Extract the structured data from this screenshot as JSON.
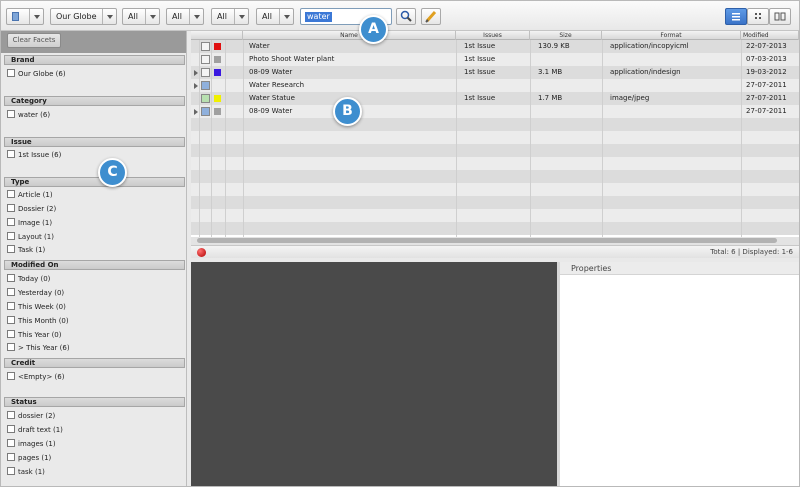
{
  "toolbar": {
    "brand_dropdown": "Our Globe",
    "filters": [
      "All",
      "All",
      "All",
      "All"
    ],
    "search_value": "water",
    "accent": "#3b78d6"
  },
  "callouts": [
    "A",
    "B",
    "C"
  ],
  "facets": {
    "clear_label": "Clear Facets",
    "groups": [
      {
        "title": "Brand",
        "items": [
          "Our Globe (6)"
        ]
      },
      {
        "title": "Category",
        "items": [
          "water (6)"
        ]
      },
      {
        "title": "Issue",
        "items": [
          "1st Issue (6)"
        ]
      },
      {
        "title": "Type",
        "items": [
          "Article (1)",
          "Dossier (2)",
          "Image (1)",
          "Layout (1)",
          "Task (1)"
        ]
      },
      {
        "title": "Modified On",
        "items": [
          "Today (0)",
          "Yesterday (0)",
          "This Week (0)",
          "This Month (0)",
          "This Year (0)",
          "> This Year (6)"
        ]
      },
      {
        "title": "Credit",
        "items": [
          "<Empty> (6)"
        ]
      },
      {
        "title": "Status",
        "items": [
          "dossier (2)",
          "draft text (1)",
          "images (1)",
          "pages (1)",
          "task (1)"
        ]
      }
    ]
  },
  "grid": {
    "columns": [
      "Name",
      "Issues",
      "Size",
      "Format",
      "Modified"
    ],
    "rows": [
      {
        "name": "Water",
        "issue": "1st Issue",
        "size": "130.9 KB",
        "format": "application/incopyicml",
        "modified": "22-07-2013",
        "color": "#e01010",
        "icon": "article-icon",
        "expandable": false
      },
      {
        "name": "Photo Shoot Water plant",
        "issue": "1st Issue",
        "size": "",
        "format": "",
        "modified": "07-03-2013",
        "color": "#a0a0a0",
        "icon": "task-icon",
        "expandable": false
      },
      {
        "name": "08-09 Water",
        "issue": "1st Issue",
        "size": "3.1 MB",
        "format": "application/indesign",
        "modified": "19-03-2012",
        "color": "#3a18e0",
        "icon": "layout-icon",
        "expandable": true
      },
      {
        "name": "Water Research",
        "issue": "",
        "size": "",
        "format": "",
        "modified": "27-07-2011",
        "color": "",
        "icon": "dossier-icon",
        "expandable": true
      },
      {
        "name": "Water Statue",
        "issue": "1st Issue",
        "size": "1.7 MB",
        "format": "image/jpeg",
        "modified": "27-07-2011",
        "color": "#f0f000",
        "icon": "image-icon",
        "expandable": false
      },
      {
        "name": "08-09 Water",
        "issue": "",
        "size": "",
        "format": "",
        "modified": "27-07-2011",
        "color": "#a0a0a0",
        "icon": "dossier-icon",
        "expandable": true
      }
    ]
  },
  "status": {
    "text": "Total: 6 | Displayed: 1-6"
  },
  "properties": {
    "title": "Properties"
  }
}
